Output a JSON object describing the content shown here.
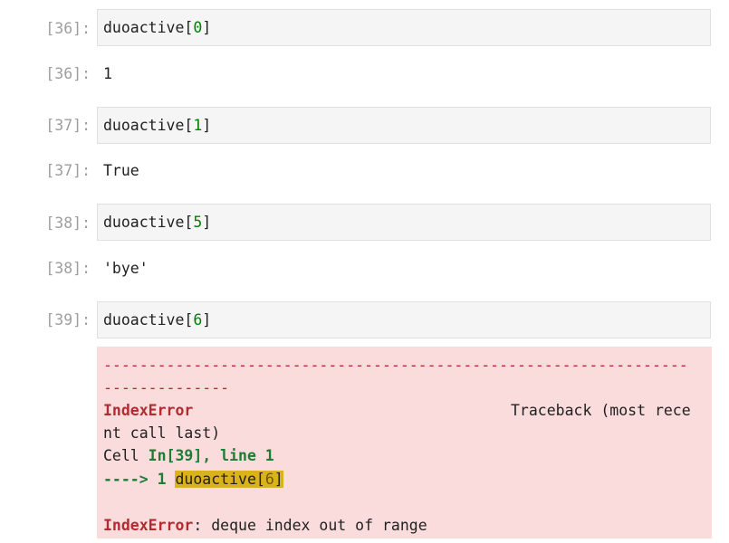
{
  "cells": [
    {
      "in_prompt": "[36]:",
      "code": {
        "name": "duoactive",
        "open": "[",
        "index": "0",
        "close": "]"
      },
      "out_prompt": "[36]:",
      "output": "1"
    },
    {
      "in_prompt": "[37]:",
      "code": {
        "name": "duoactive",
        "open": "[",
        "index": "1",
        "close": "]"
      },
      "out_prompt": "[37]:",
      "output": "True"
    },
    {
      "in_prompt": "[38]:",
      "code": {
        "name": "duoactive",
        "open": "[",
        "index": "5",
        "close": "]"
      },
      "out_prompt": "[38]:",
      "output": "'bye'"
    },
    {
      "in_prompt": "[39]:",
      "code": {
        "name": "duoactive",
        "open": "[",
        "index": "6",
        "close": "]"
      }
    }
  ],
  "traceback": {
    "dashes_line1": "-----------------------------------------------------------------",
    "dashes_line2": "--------------",
    "error_name": "IndexError",
    "traceback_header": "Traceback (most rece",
    "traceback_header_wrap": "nt call last)",
    "cell_label": "Cell ",
    "cell_ref": "In[39], line 1",
    "arrow": "----> 1 ",
    "hl_name": "duoactive",
    "hl_open": "[",
    "hl_index": "6",
    "hl_close": "]",
    "final_error_name": "IndexError",
    "final_message": ": deque index out of range"
  },
  "colors": {
    "input_bg": "#f5f5f5",
    "error_bg": "#fadcdc",
    "number_green": "#008000",
    "error_red": "#b22b31",
    "highlight": "#d9b21c",
    "prompt_gray": "#9e9e9e"
  }
}
